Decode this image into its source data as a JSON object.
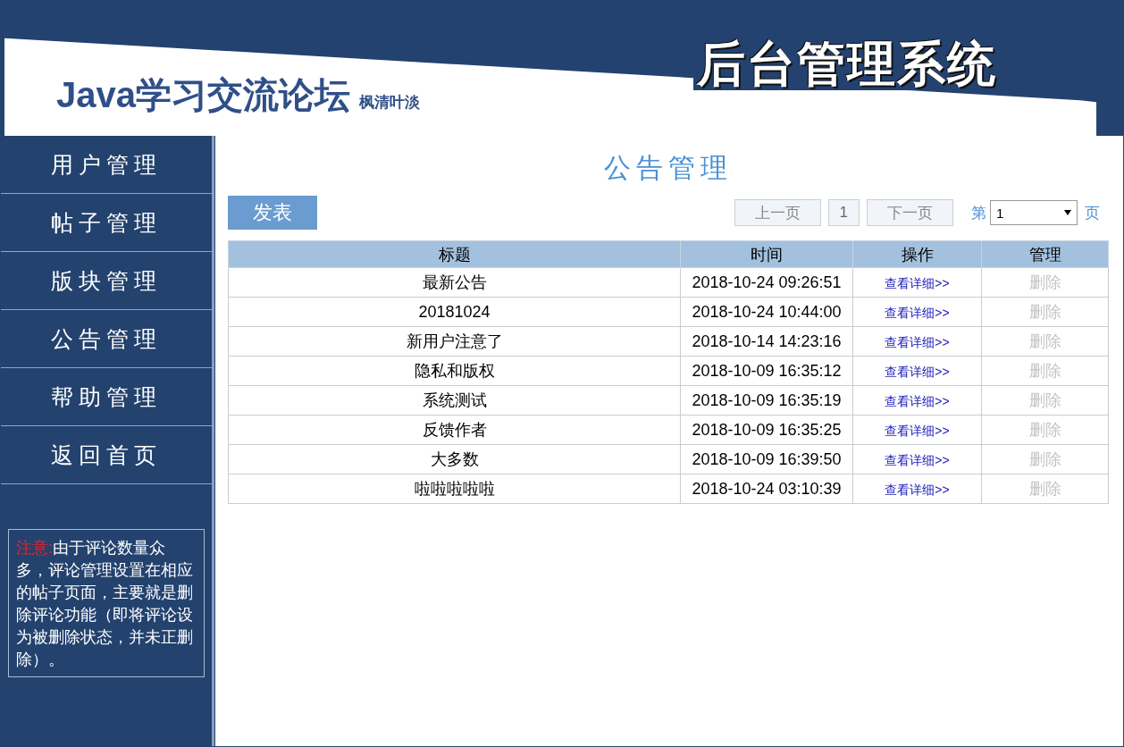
{
  "header": {
    "site_title": "Java学习交流论坛",
    "subtitle": "枫清叶淡",
    "system_title": "后台管理系统"
  },
  "sidebar": {
    "items": [
      {
        "label": "用户管理",
        "selected": false
      },
      {
        "label": "帖子管理",
        "selected": false
      },
      {
        "label": "版块管理",
        "selected": false
      },
      {
        "label": "公告管理",
        "selected": false
      },
      {
        "label": "帮助管理",
        "selected": false
      },
      {
        "label": "返回首页",
        "selected": false
      }
    ],
    "note": {
      "label": "注意:",
      "text": "由于评论数量众多，评论管理设置在相应的帖子页面，主要就是删除评论功能（即将评论设为被删除状态，并未正删除）。"
    }
  },
  "main": {
    "title": "公告管理",
    "publish_button": "发表",
    "pagination": {
      "prev": "上一页",
      "current": "1",
      "next": "下一页",
      "prefix": "第",
      "page_select": "1",
      "suffix": "页",
      "prev_disabled": true,
      "next_disabled": true
    },
    "table": {
      "columns": [
        "标题",
        "时间",
        "操作",
        "管理"
      ],
      "rows": [
        {
          "title": "最新公告",
          "time": "2018-10-24 09:26:51",
          "action": "查看详细>>",
          "manage": "删除",
          "manage_disabled": true
        },
        {
          "title": "20181024",
          "time": "2018-10-24 10:44:00",
          "action": "查看详细>>",
          "manage": "删除",
          "manage_disabled": true
        },
        {
          "title": "新用户注意了",
          "time": "2018-10-14 14:23:16",
          "action": "查看详细>>",
          "manage": "删除",
          "manage_disabled": true
        },
        {
          "title": "隐私和版权",
          "time": "2018-10-09 16:35:12",
          "action": "查看详细>>",
          "manage": "删除",
          "manage_disabled": true
        },
        {
          "title": "系统测试",
          "time": "2018-10-09 16:35:19",
          "action": "查看详细>>",
          "manage": "删除",
          "manage_disabled": true
        },
        {
          "title": "反馈作者",
          "time": "2018-10-09 16:35:25",
          "action": "查看详细>>",
          "manage": "删除",
          "manage_disabled": true
        },
        {
          "title": "大多数",
          "time": "2018-10-09 16:39:50",
          "action": "查看详细>>",
          "manage": "删除",
          "manage_disabled": true
        },
        {
          "title": "啦啦啦啦啦",
          "time": "2018-10-24 03:10:39",
          "action": "查看详细>>",
          "manage": "删除",
          "manage_disabled": true
        }
      ]
    }
  }
}
